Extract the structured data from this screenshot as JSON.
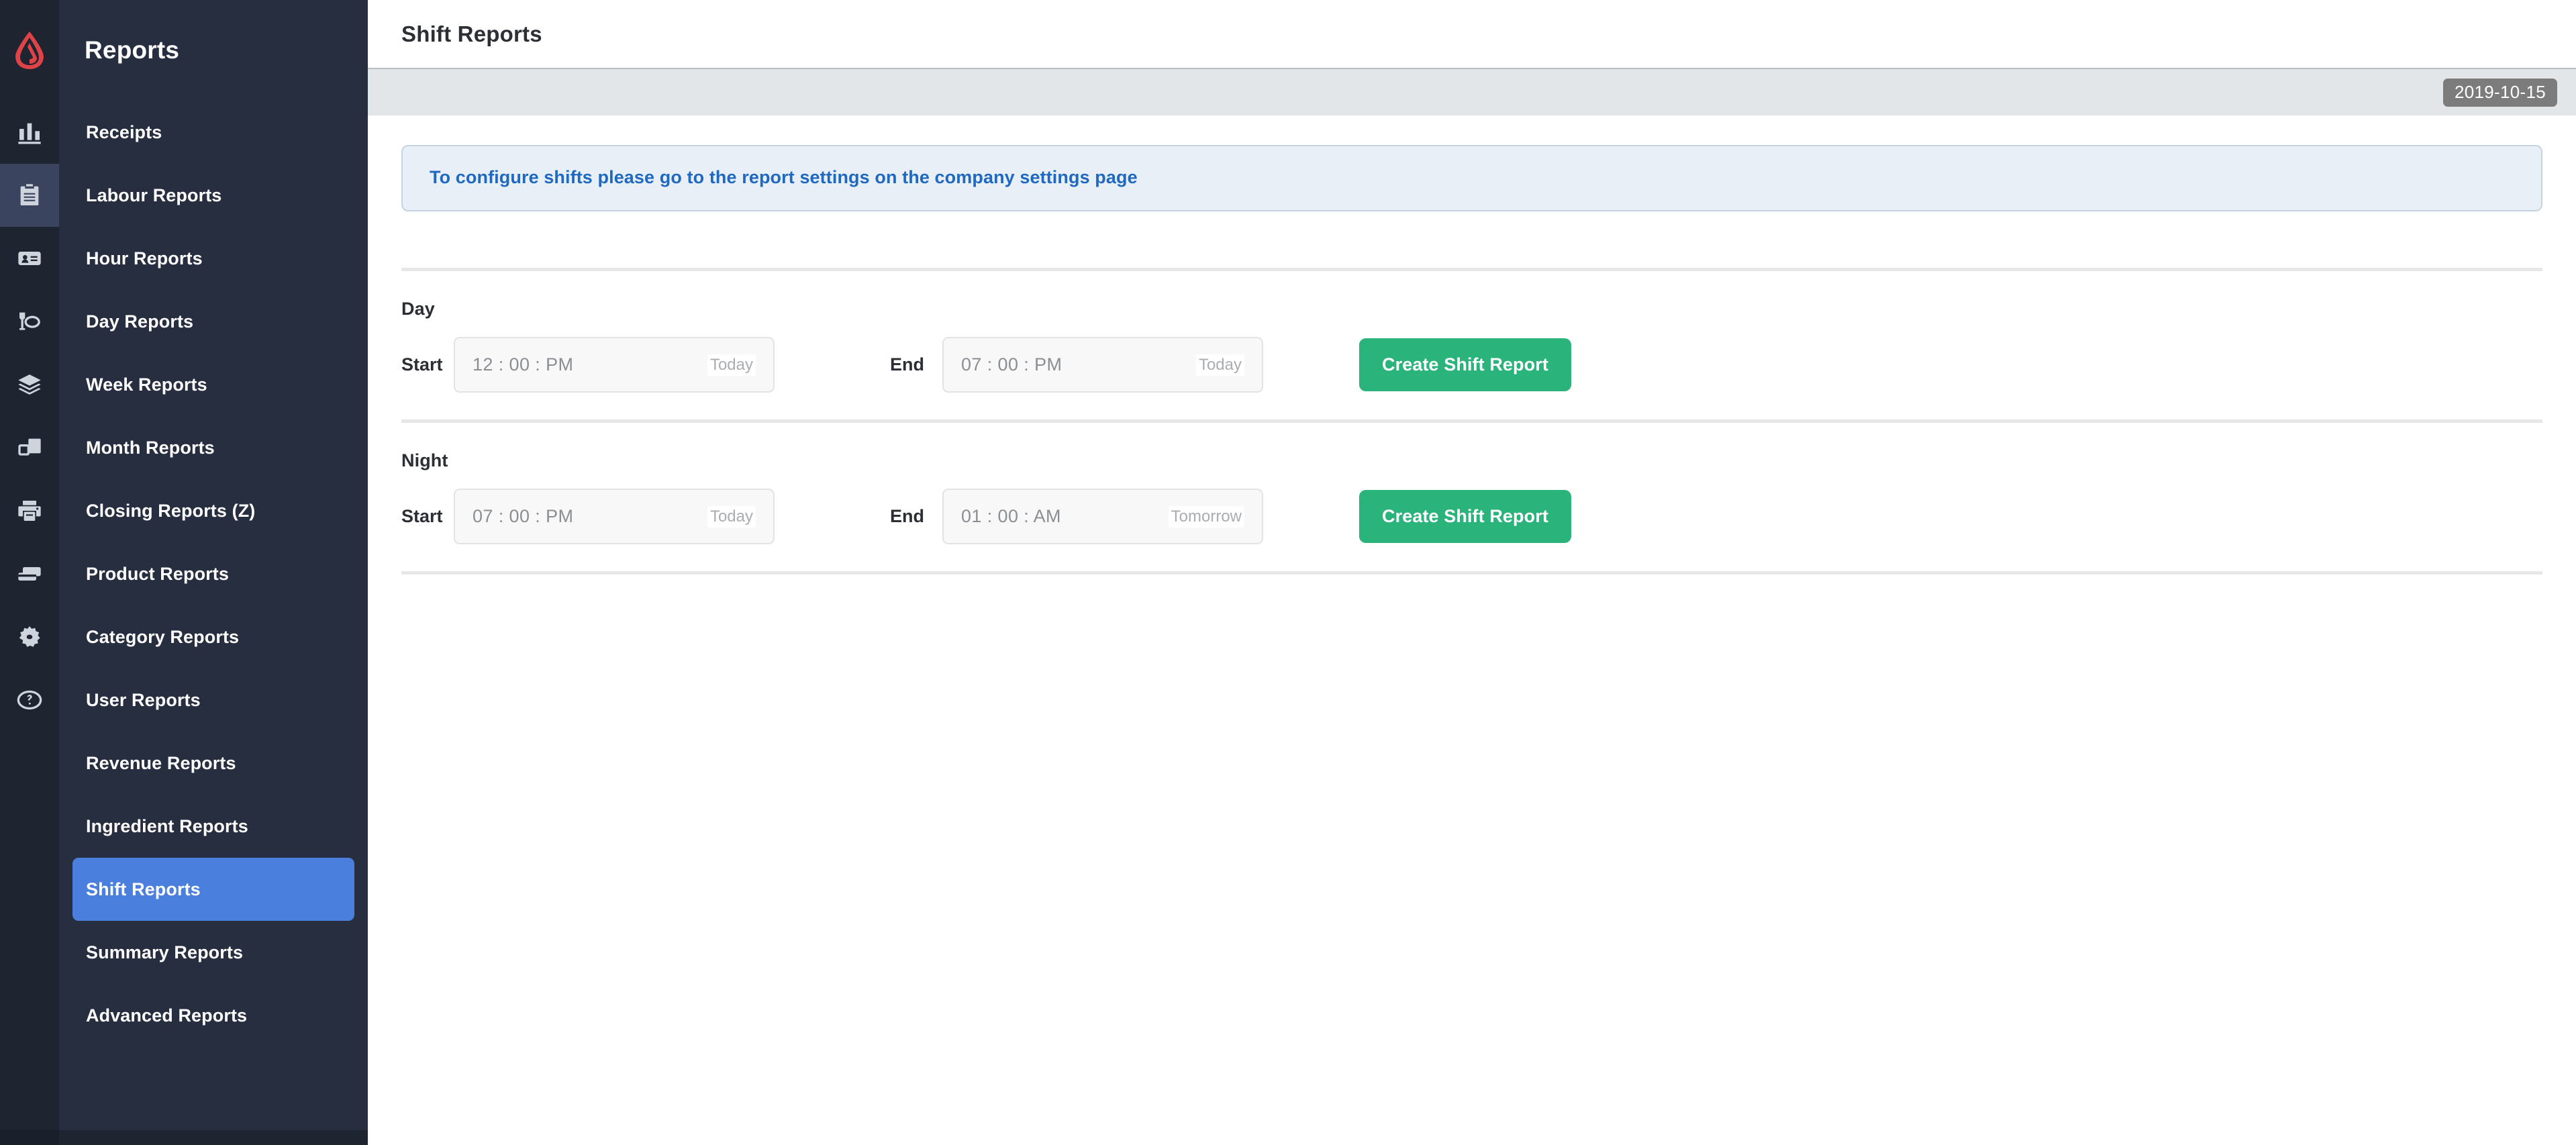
{
  "brand": {
    "logo_icon": "lightspeed-flame-logo",
    "logo_color": "#e04347"
  },
  "icon_rail": {
    "items": [
      {
        "icon": "bar-chart-icon",
        "active": false
      },
      {
        "icon": "clipboard-icon",
        "active": true
      },
      {
        "icon": "id-card-icon",
        "active": false
      },
      {
        "icon": "dining-icon",
        "active": false
      },
      {
        "icon": "layers-icon",
        "active": false
      },
      {
        "icon": "windows-icon",
        "active": false
      },
      {
        "icon": "printer-icon",
        "active": false
      },
      {
        "icon": "card-terminal-icon",
        "active": false
      },
      {
        "icon": "gear-icon",
        "active": false
      },
      {
        "icon": "help-circle-icon",
        "active": false
      }
    ]
  },
  "sidebar": {
    "title": "Reports",
    "active_index": 12,
    "accent_color": "#4a7fdd",
    "items": [
      {
        "label": "Receipts"
      },
      {
        "label": "Labour Reports"
      },
      {
        "label": "Hour Reports"
      },
      {
        "label": "Day Reports"
      },
      {
        "label": "Week Reports"
      },
      {
        "label": "Month Reports"
      },
      {
        "label": "Closing Reports (Z)"
      },
      {
        "label": "Product Reports"
      },
      {
        "label": "Category Reports"
      },
      {
        "label": "User Reports"
      },
      {
        "label": "Revenue Reports"
      },
      {
        "label": "Ingredient Reports"
      },
      {
        "label": "Shift Reports"
      },
      {
        "label": "Summary Reports"
      },
      {
        "label": "Advanced Reports"
      }
    ]
  },
  "header": {
    "title": "Shift Reports",
    "date_badge": "2019-10-15"
  },
  "banner": {
    "text": "To configure shifts please go to the report settings on the company settings page",
    "text_color": "#2069c0",
    "background_color": "#e8eff7"
  },
  "shifts": [
    {
      "name": "Day",
      "start_label": "Start",
      "start_value": "12 : 00 : PM",
      "start_suffix": "Today",
      "end_label": "End",
      "end_value": "07 : 00 : PM",
      "end_suffix": "Today",
      "button_label": "Create Shift Report"
    },
    {
      "name": "Night",
      "start_label": "Start",
      "start_value": "07 : 00 : PM",
      "start_suffix": "Today",
      "end_label": "End",
      "end_value": "01 : 00 : AM",
      "end_suffix": "Tomorrow",
      "button_label": "Create Shift Report"
    }
  ],
  "colors": {
    "button_green": "#2bb37c",
    "sidebar_bg": "#262e40",
    "rail_bg": "#1e2430",
    "badge_gray": "#7c7c7c"
  }
}
